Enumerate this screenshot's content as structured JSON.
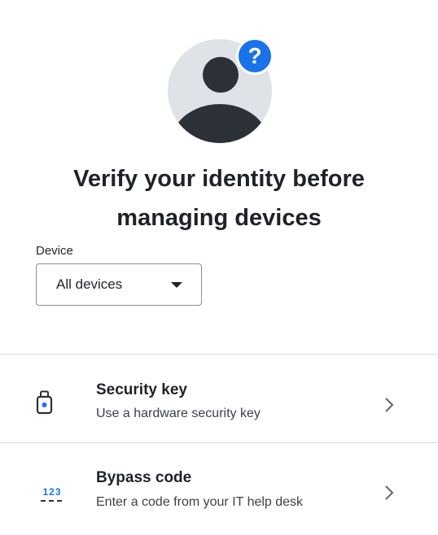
{
  "header": {
    "help_badge": "?",
    "title_line1": "Verify your identity before",
    "title_line2": "managing devices"
  },
  "device_filter": {
    "label": "Device",
    "selected": "All devices"
  },
  "options": [
    {
      "title": "Security key",
      "description": "Use a hardware security key",
      "icon": "security-key-icon"
    },
    {
      "title": "Bypass code",
      "description": "Enter a code from your IT help desk",
      "icon": "bypass-code-icon",
      "icon_text": "123"
    }
  ],
  "colors": {
    "accent": "#1a73e8",
    "text": "#1f2328",
    "avatar_bg": "#dfe3e8",
    "avatar_fg": "#2c3137",
    "divider": "#d5d9de"
  }
}
